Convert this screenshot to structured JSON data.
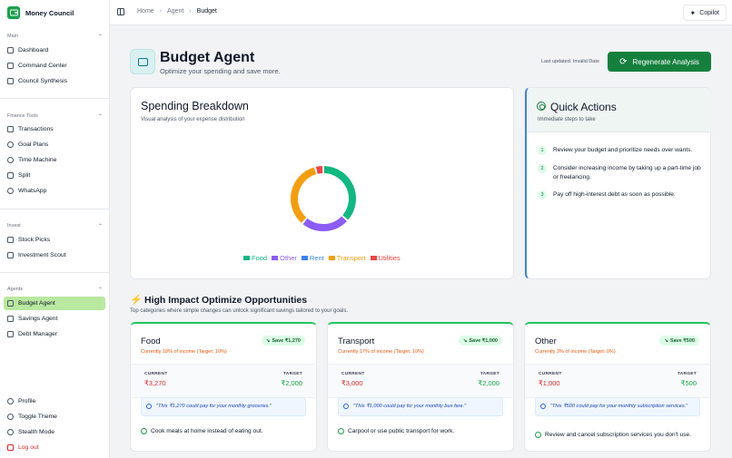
{
  "app": {
    "name": "Money Council"
  },
  "sidebar": {
    "groups": [
      {
        "label": "Main",
        "items": [
          {
            "label": "Dashboard"
          },
          {
            "label": "Command Center"
          },
          {
            "label": "Council Synthesis"
          }
        ]
      },
      {
        "label": "Finance Tools",
        "items": [
          {
            "label": "Transactions"
          },
          {
            "label": "Goal Plans"
          },
          {
            "label": "Time Machine"
          },
          {
            "label": "Split"
          },
          {
            "label": "WhatsApp"
          }
        ]
      },
      {
        "label": "Invest",
        "items": [
          {
            "label": "Stock Picks"
          },
          {
            "label": "Investment Scout"
          }
        ]
      },
      {
        "label": "Agents",
        "items": [
          {
            "label": "Budget Agent"
          },
          {
            "label": "Savings Agent"
          },
          {
            "label": "Debt Manager"
          }
        ]
      }
    ],
    "footer": [
      {
        "label": "Profile"
      },
      {
        "label": "Toggle Theme"
      },
      {
        "label": "Stealth Mode"
      },
      {
        "label": "Log out"
      }
    ]
  },
  "breadcrumb": [
    "Home",
    "Agent",
    "Budget"
  ],
  "copilot_label": "Copilot",
  "header": {
    "title": "Budget Agent",
    "subtitle": "Optimize your spending and save more.",
    "updated": "Last updated: Invalid Date",
    "regen_label": "Regenerate Analysis"
  },
  "spending": {
    "title": "Spending Breakdown",
    "subtitle": "Visual analysis of your expense distribution"
  },
  "chart_data": {
    "type": "pie",
    "categories": [
      "Food",
      "Other",
      "Rent",
      "Transport",
      "Utilities"
    ],
    "values": [
      18,
      12,
      0,
      17,
      2
    ],
    "colors": [
      "#10b981",
      "#8b5cf6",
      "#3b82f6",
      "#f59e0b",
      "#ef4444"
    ]
  },
  "quick_actions": {
    "title": "Quick Actions",
    "subtitle": "Immediate steps to take",
    "items": [
      {
        "num": "1",
        "text": "Review your budget and prioritize needs over wants."
      },
      {
        "num": "2",
        "text": "Consider increasing income by taking up a part-time job or freelancing."
      },
      {
        "num": "3",
        "text": "Pay off high-interest debt as soon as possible."
      }
    ]
  },
  "opportunities": {
    "title": "High Impact Optimize Opportunities",
    "subtitle": "Top categories where simple changes can unlock significant savings tailored to your goals.",
    "current_label": "CURRENT",
    "target_label": "TARGET",
    "cards": [
      {
        "name": "Food",
        "pct": "Currently 18% of income (Target: 10%)",
        "save": "Save ₹1,270",
        "current": "₹3,270",
        "target": "₹2,000",
        "quote": "\"This ₹1,270 could pay for your monthly groceries.\"",
        "tip": "Cook meals at home instead of eating out."
      },
      {
        "name": "Transport",
        "pct": "Currently 17% of income (Target: 10%)",
        "save": "Save ₹1,000",
        "current": "₹3,000",
        "target": "₹2,000",
        "quote": "\"This ₹1,000 could pay for your monthly bus fare.\"",
        "tip": "Carpool or use public transport for work."
      },
      {
        "name": "Other",
        "pct": "Currently 3% of income (Target: 0%)",
        "save": "Save ₹500",
        "current": "₹1,000",
        "target": "₹500",
        "quote": "\"This ₹500 could pay for your monthly subscription services.\"",
        "tip": "Review and cancel subscription services you don't use."
      }
    ]
  }
}
